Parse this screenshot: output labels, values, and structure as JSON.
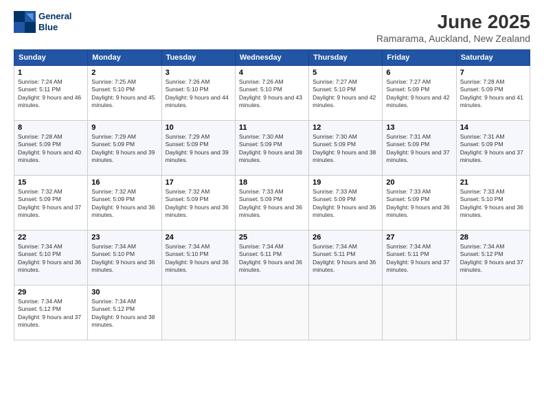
{
  "logo": {
    "line1": "General",
    "line2": "Blue"
  },
  "title": "June 2025",
  "location": "Ramarama, Auckland, New Zealand",
  "headers": [
    "Sunday",
    "Monday",
    "Tuesday",
    "Wednesday",
    "Thursday",
    "Friday",
    "Saturday"
  ],
  "weeks": [
    [
      {
        "day": "1",
        "sunrise": "7:24 AM",
        "sunset": "5:11 PM",
        "daylight": "9 hours and 46 minutes."
      },
      {
        "day": "2",
        "sunrise": "7:25 AM",
        "sunset": "5:10 PM",
        "daylight": "9 hours and 45 minutes."
      },
      {
        "day": "3",
        "sunrise": "7:26 AM",
        "sunset": "5:10 PM",
        "daylight": "9 hours and 44 minutes."
      },
      {
        "day": "4",
        "sunrise": "7:26 AM",
        "sunset": "5:10 PM",
        "daylight": "9 hours and 43 minutes."
      },
      {
        "day": "5",
        "sunrise": "7:27 AM",
        "sunset": "5:10 PM",
        "daylight": "9 hours and 42 minutes."
      },
      {
        "day": "6",
        "sunrise": "7:27 AM",
        "sunset": "5:09 PM",
        "daylight": "9 hours and 42 minutes."
      },
      {
        "day": "7",
        "sunrise": "7:28 AM",
        "sunset": "5:09 PM",
        "daylight": "9 hours and 41 minutes."
      }
    ],
    [
      {
        "day": "8",
        "sunrise": "7:28 AM",
        "sunset": "5:09 PM",
        "daylight": "9 hours and 40 minutes."
      },
      {
        "day": "9",
        "sunrise": "7:29 AM",
        "sunset": "5:09 PM",
        "daylight": "9 hours and 39 minutes."
      },
      {
        "day": "10",
        "sunrise": "7:29 AM",
        "sunset": "5:09 PM",
        "daylight": "9 hours and 39 minutes."
      },
      {
        "day": "11",
        "sunrise": "7:30 AM",
        "sunset": "5:09 PM",
        "daylight": "9 hours and 38 minutes."
      },
      {
        "day": "12",
        "sunrise": "7:30 AM",
        "sunset": "5:09 PM",
        "daylight": "9 hours and 38 minutes."
      },
      {
        "day": "13",
        "sunrise": "7:31 AM",
        "sunset": "5:09 PM",
        "daylight": "9 hours and 37 minutes."
      },
      {
        "day": "14",
        "sunrise": "7:31 AM",
        "sunset": "5:09 PM",
        "daylight": "9 hours and 37 minutes."
      }
    ],
    [
      {
        "day": "15",
        "sunrise": "7:32 AM",
        "sunset": "5:09 PM",
        "daylight": "9 hours and 37 minutes."
      },
      {
        "day": "16",
        "sunrise": "7:32 AM",
        "sunset": "5:09 PM",
        "daylight": "9 hours and 36 minutes."
      },
      {
        "day": "17",
        "sunrise": "7:32 AM",
        "sunset": "5:09 PM",
        "daylight": "9 hours and 36 minutes."
      },
      {
        "day": "18",
        "sunrise": "7:33 AM",
        "sunset": "5:09 PM",
        "daylight": "9 hours and 36 minutes."
      },
      {
        "day": "19",
        "sunrise": "7:33 AM",
        "sunset": "5:09 PM",
        "daylight": "9 hours and 36 minutes."
      },
      {
        "day": "20",
        "sunrise": "7:33 AM",
        "sunset": "5:09 PM",
        "daylight": "9 hours and 36 minutes."
      },
      {
        "day": "21",
        "sunrise": "7:33 AM",
        "sunset": "5:10 PM",
        "daylight": "9 hours and 36 minutes."
      }
    ],
    [
      {
        "day": "22",
        "sunrise": "7:34 AM",
        "sunset": "5:10 PM",
        "daylight": "9 hours and 36 minutes."
      },
      {
        "day": "23",
        "sunrise": "7:34 AM",
        "sunset": "5:10 PM",
        "daylight": "9 hours and 36 minutes."
      },
      {
        "day": "24",
        "sunrise": "7:34 AM",
        "sunset": "5:10 PM",
        "daylight": "9 hours and 36 minutes."
      },
      {
        "day": "25",
        "sunrise": "7:34 AM",
        "sunset": "5:11 PM",
        "daylight": "9 hours and 36 minutes."
      },
      {
        "day": "26",
        "sunrise": "7:34 AM",
        "sunset": "5:11 PM",
        "daylight": "9 hours and 36 minutes."
      },
      {
        "day": "27",
        "sunrise": "7:34 AM",
        "sunset": "5:11 PM",
        "daylight": "9 hours and 37 minutes."
      },
      {
        "day": "28",
        "sunrise": "7:34 AM",
        "sunset": "5:12 PM",
        "daylight": "9 hours and 37 minutes."
      }
    ],
    [
      {
        "day": "29",
        "sunrise": "7:34 AM",
        "sunset": "5:12 PM",
        "daylight": "9 hours and 37 minutes."
      },
      {
        "day": "30",
        "sunrise": "7:34 AM",
        "sunset": "5:12 PM",
        "daylight": "9 hours and 38 minutes."
      },
      null,
      null,
      null,
      null,
      null
    ]
  ]
}
